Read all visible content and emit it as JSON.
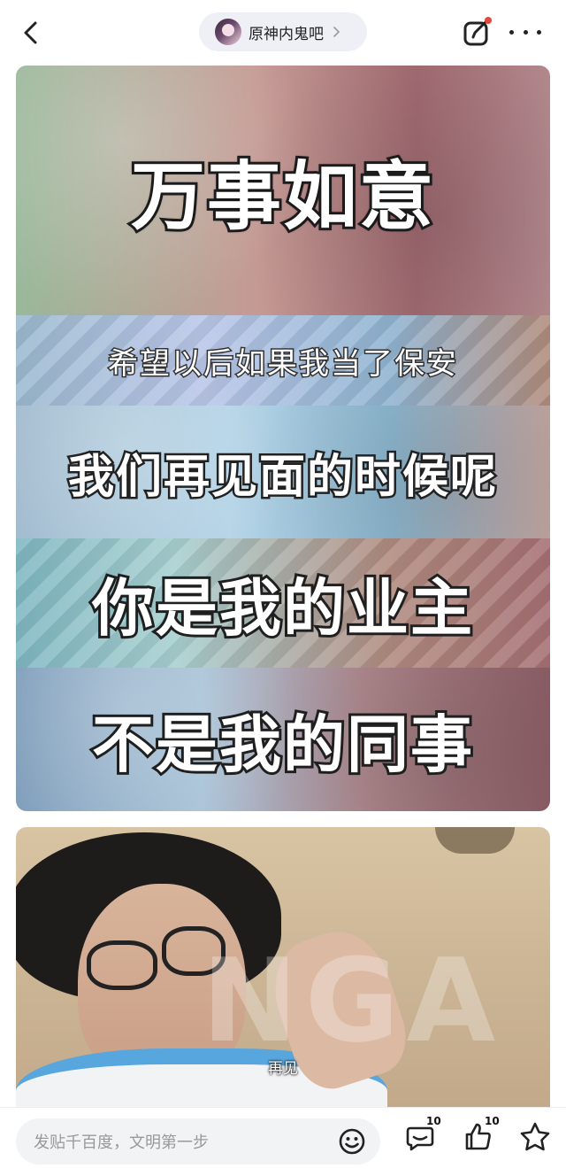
{
  "header": {
    "forum_name": "原神内鬼吧"
  },
  "post": {
    "meme1_lines": [
      "万事如意",
      "希望以后如果我当了保安",
      "我们再见面的时候呢",
      "你是我的业主",
      "不是我的同事"
    ],
    "meme2_watermark": "NGA",
    "meme2_caption": "再见"
  },
  "bottom_bar": {
    "reply_placeholder": "发贴千百度，文明第一步",
    "comment_count": "10",
    "like_count": "10"
  },
  "colors": {
    "accent_dot": "#e8453c",
    "pill_bg": "#eef0f6",
    "input_bg": "#f2f3f5"
  }
}
